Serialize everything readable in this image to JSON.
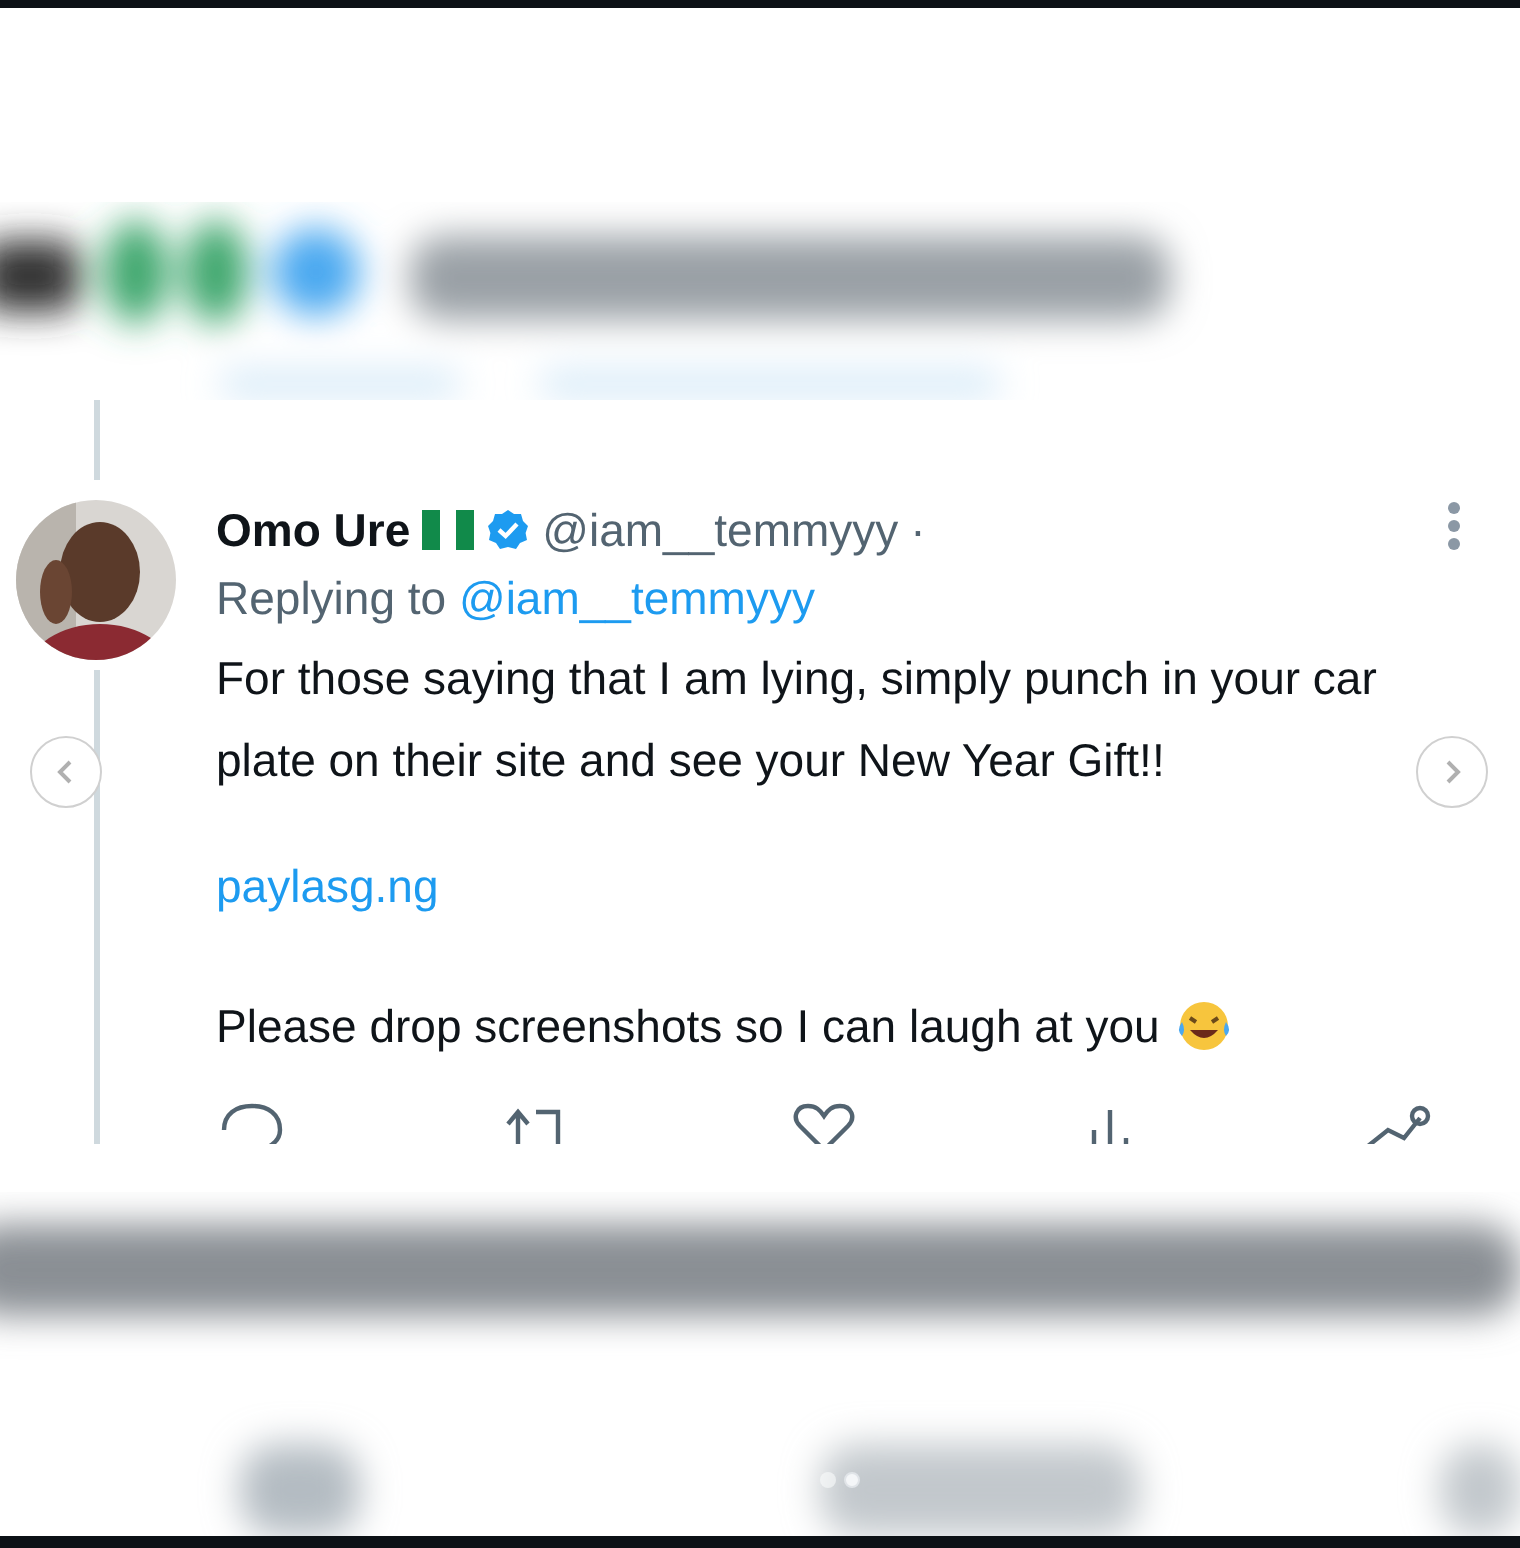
{
  "author": {
    "name": "Omo Ure",
    "handle": "@iam__temmyyy",
    "separator": "·"
  },
  "reply": {
    "label": "Replying to",
    "handle": "@iam__temmyyy"
  },
  "body": "For those saying that I am lying, simply punch in your car plate on their site and see your New Year Gift!!",
  "link": "paylasg.ng",
  "closing": "Please drop screenshots so I can laugh at you",
  "actions": [
    {
      "kind": "reply"
    },
    {
      "kind": "retweet"
    },
    {
      "kind": "like"
    },
    {
      "kind": "views"
    },
    {
      "kind": "share"
    }
  ],
  "carousel": {
    "dots": [
      {
        "selected": false
      },
      {
        "selected": true
      }
    ]
  }
}
